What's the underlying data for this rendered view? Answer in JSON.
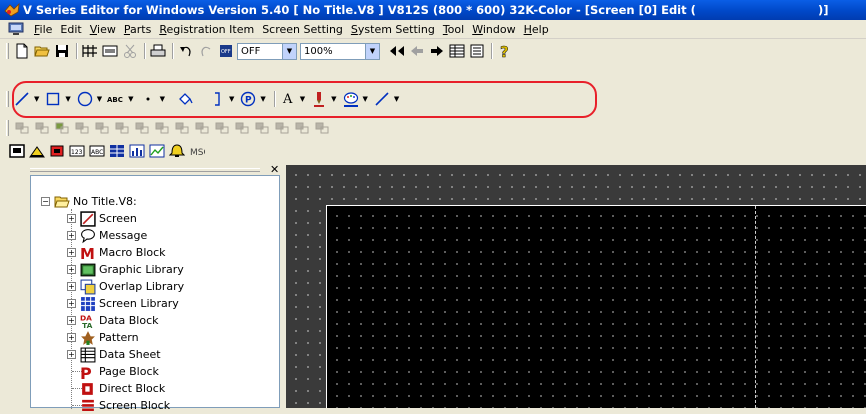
{
  "window": {
    "title": "V Series Editor for Windows Version 5.40 [ No Title.V8 ] V812S (800 * 600) 32K-Color - [Screen [0] Edit (",
    "title_end": ")]",
    "title_bar_color": "#0048c8"
  },
  "menu": {
    "items": [
      {
        "ul": "F",
        "rest": "ile"
      },
      {
        "ul": "",
        "rest": "Edit"
      },
      {
        "ul": "V",
        "rest": "iew"
      },
      {
        "ul": "P",
        "rest": "arts"
      },
      {
        "ul": "R",
        "rest": "egistration Item"
      },
      {
        "ul": "",
        "rest": "Screen Setting"
      },
      {
        "ul": "S",
        "rest": "ystem Setting"
      },
      {
        "ul": "T",
        "rest": "ool"
      },
      {
        "ul": "W",
        "rest": "indow"
      },
      {
        "ul": "H",
        "rest": "elp"
      }
    ]
  },
  "toolbar1": {
    "mode_combo": "OFF",
    "zoom_combo": "100%"
  },
  "toolbar2": {
    "text_style_label": "ABC",
    "font_button": "A",
    "highlight_color": "#e8202a"
  },
  "panel": {
    "root": "No Title.V8:",
    "items": [
      {
        "label": "Screen",
        "icon": "screen-icon",
        "expandable": true
      },
      {
        "label": "Message",
        "icon": "message-icon",
        "expandable": true
      },
      {
        "label": "Macro Block",
        "icon": "macro-block-icon",
        "expandable": true
      },
      {
        "label": "Graphic Library",
        "icon": "graphic-library-icon",
        "expandable": true
      },
      {
        "label": "Overlap Library",
        "icon": "overlap-library-icon",
        "expandable": true
      },
      {
        "label": "Screen Library",
        "icon": "screen-library-icon",
        "expandable": true
      },
      {
        "label": "Data Block",
        "icon": "data-block-icon",
        "expandable": true
      },
      {
        "label": "Pattern",
        "icon": "pattern-icon",
        "expandable": true
      },
      {
        "label": "Data Sheet",
        "icon": "data-sheet-icon",
        "expandable": true
      },
      {
        "label": "Page Block",
        "icon": "page-block-icon",
        "expandable": false
      },
      {
        "label": "Direct Block",
        "icon": "direct-block-icon",
        "expandable": false
      },
      {
        "label": "Screen Block",
        "icon": "screen-block-icon",
        "expandable": false
      }
    ]
  }
}
